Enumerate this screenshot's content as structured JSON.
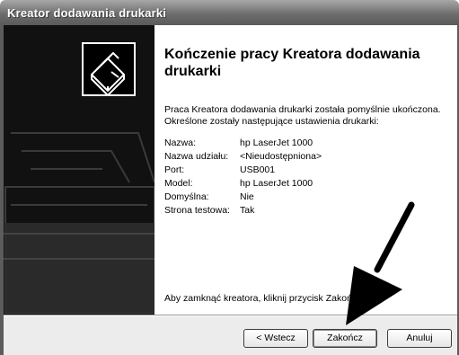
{
  "window": {
    "title": "Kreator dodawania drukarki"
  },
  "icons": {
    "wizard_image": "printer-icon",
    "annotation": "arrow-pointer"
  },
  "content": {
    "heading": "Kończenie pracy Kreatora dodawania drukarki",
    "intro": "Praca Kreatora dodawania drukarki została pomyślnie ukończona. Określone zostały następujące ustawienia drukarki:",
    "settings": [
      {
        "label": "Nazwa:",
        "value": "hp LaserJet 1000"
      },
      {
        "label": "Nazwa udziału:",
        "value": "<Nieudostępniona>"
      },
      {
        "label": "Port:",
        "value": "USB001"
      },
      {
        "label": "Model:",
        "value": "hp LaserJet 1000"
      },
      {
        "label": "Domyślna:",
        "value": "Nie"
      },
      {
        "label": "Strona testowa:",
        "value": "Tak"
      }
    ],
    "closing": "Aby zamknąć kreatora, kliknij przycisk Zakończ."
  },
  "buttons": {
    "back": "< Wstecz",
    "finish": "Zakończ",
    "cancel": "Anuluj"
  },
  "colors": {
    "titlebar": "#6e6e6e",
    "side_panel": "#111111",
    "button_bar": "#ececec"
  }
}
